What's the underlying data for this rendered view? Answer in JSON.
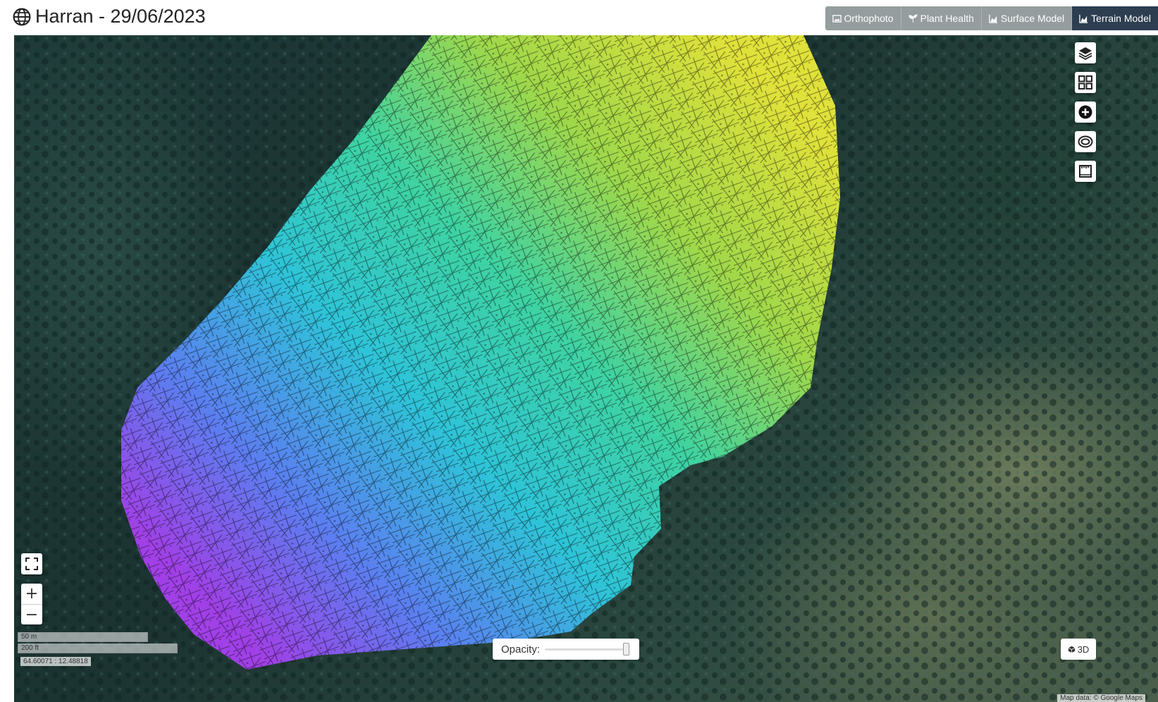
{
  "header": {
    "title": "Harran - 29/06/2023",
    "title_icon": "globe-icon"
  },
  "tabs": [
    {
      "label": "Orthophoto",
      "icon": "image-icon",
      "active": false
    },
    {
      "label": "Plant Health",
      "icon": "seedling-icon",
      "active": false
    },
    {
      "label": "Surface Model",
      "icon": "area-chart-icon",
      "active": false
    },
    {
      "label": "Terrain Model",
      "icon": "area-chart-icon",
      "active": true
    }
  ],
  "map": {
    "controls_right": [
      "layers-icon",
      "grid-icon",
      "plus-circle-icon",
      "eye-ring-icon",
      "measure-icon"
    ],
    "fullscreen_icon": "fullscreen-icon",
    "zoom_in": "+",
    "zoom_out": "−",
    "scale_metric": "50 m",
    "scale_imperial": "200 ft",
    "coordinates": "64.60071 : 12.48818",
    "opacity": {
      "label": "Opacity:",
      "value": 1.0
    },
    "button_3d": "3D",
    "attribution": "Map data: © Google Maps"
  },
  "colors": {
    "active_tab": "#2c3e50",
    "tab_bar": "#959d9e",
    "dem_low": "#9b3ae0",
    "dem_mid": "#27c6c6",
    "dem_high": "#d7e23a"
  }
}
